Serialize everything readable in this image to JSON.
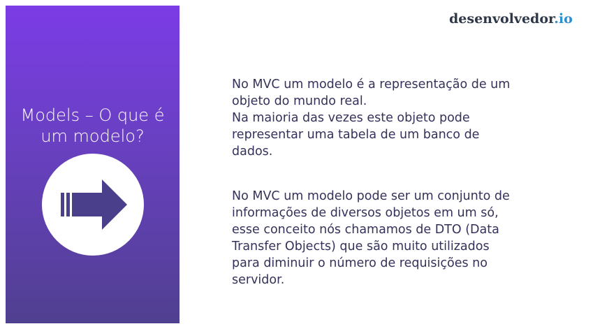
{
  "brand": {
    "name": "desenvolvedor",
    "tld": ".io"
  },
  "side_panel": {
    "title_line_1": "Models – O que é",
    "title_line_2": "um modelo?",
    "icon": "arrow-right-icon"
  },
  "content": {
    "paragraph_1": "No MVC um modelo é a representação de um objeto do mundo real.\nNa maioria das vezes este objeto pode representar uma tabela de um banco de dados.",
    "paragraph_2": "No MVC um modelo pode ser um conjunto de informações de diversos objetos em um só, esse conceito nós chamamos de DTO (Data Transfer Objects) que são muito utilizados para diminuir o número de requisições no servidor."
  },
  "colors": {
    "panel_top": "#7c3ce6",
    "panel_bottom": "#504090",
    "text": "#34325a",
    "brand_text": "#2d3748",
    "brand_accent": "#2b8fd0"
  }
}
